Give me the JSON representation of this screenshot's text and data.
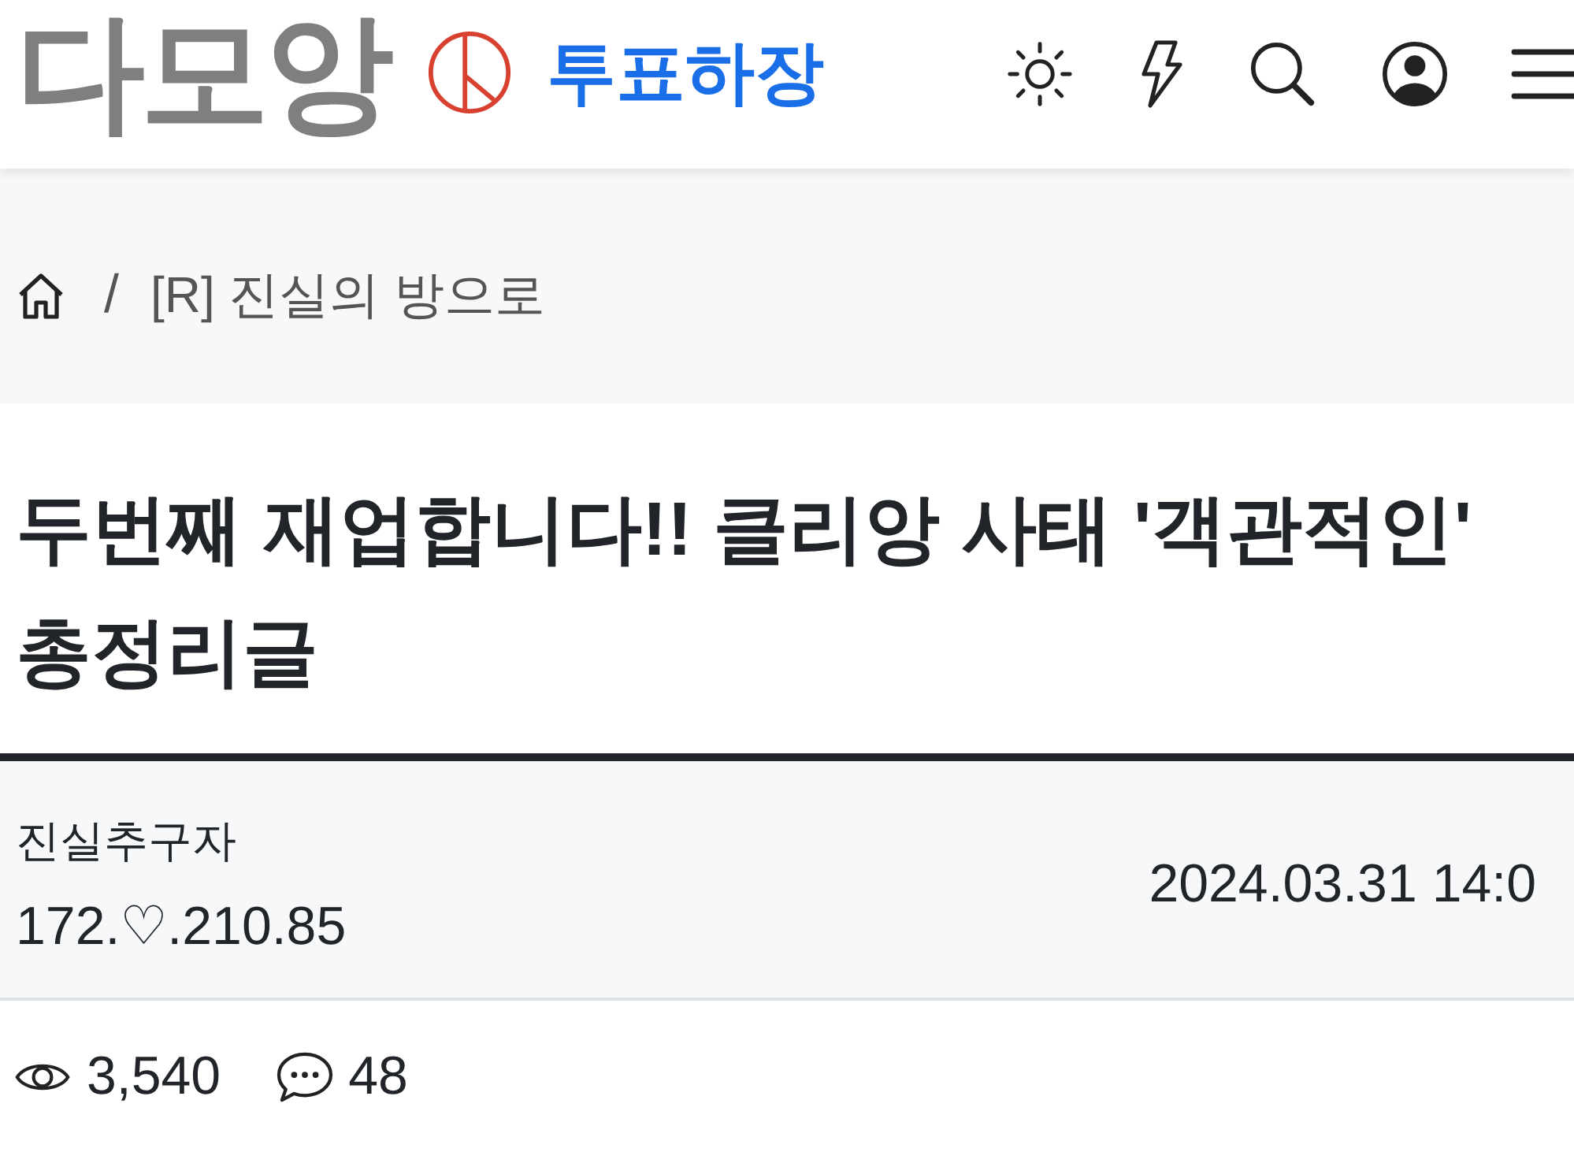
{
  "header": {
    "logo": "다모앙",
    "banner": "투표하장"
  },
  "breadcrumb": {
    "separator": "/",
    "current": "[R] 진실의 방으로"
  },
  "post": {
    "title": "두번째 재업합니다!! 클리앙 사태 '객관적인' 총정리글",
    "author": "진실추구자",
    "ip": "172.♡.210.85",
    "date": "2024.03.31 14:0",
    "views": "3,540",
    "comments": "48"
  }
}
